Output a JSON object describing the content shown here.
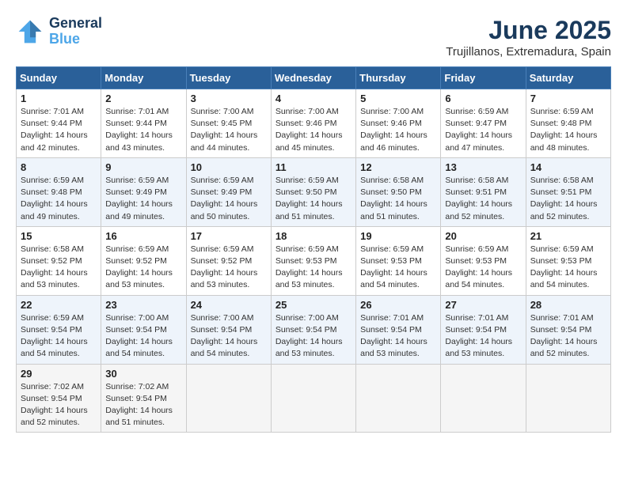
{
  "header": {
    "logo_line1": "General",
    "logo_line2": "Blue",
    "month": "June 2025",
    "location": "Trujillanos, Extremadura, Spain"
  },
  "weekdays": [
    "Sunday",
    "Monday",
    "Tuesday",
    "Wednesday",
    "Thursday",
    "Friday",
    "Saturday"
  ],
  "weeks": [
    [
      {
        "day": "1",
        "info": "Sunrise: 7:01 AM\nSunset: 9:44 PM\nDaylight: 14 hours\nand 42 minutes."
      },
      {
        "day": "2",
        "info": "Sunrise: 7:01 AM\nSunset: 9:44 PM\nDaylight: 14 hours\nand 43 minutes."
      },
      {
        "day": "3",
        "info": "Sunrise: 7:00 AM\nSunset: 9:45 PM\nDaylight: 14 hours\nand 44 minutes."
      },
      {
        "day": "4",
        "info": "Sunrise: 7:00 AM\nSunset: 9:46 PM\nDaylight: 14 hours\nand 45 minutes."
      },
      {
        "day": "5",
        "info": "Sunrise: 7:00 AM\nSunset: 9:46 PM\nDaylight: 14 hours\nand 46 minutes."
      },
      {
        "day": "6",
        "info": "Sunrise: 6:59 AM\nSunset: 9:47 PM\nDaylight: 14 hours\nand 47 minutes."
      },
      {
        "day": "7",
        "info": "Sunrise: 6:59 AM\nSunset: 9:48 PM\nDaylight: 14 hours\nand 48 minutes."
      }
    ],
    [
      {
        "day": "8",
        "info": "Sunrise: 6:59 AM\nSunset: 9:48 PM\nDaylight: 14 hours\nand 49 minutes."
      },
      {
        "day": "9",
        "info": "Sunrise: 6:59 AM\nSunset: 9:49 PM\nDaylight: 14 hours\nand 49 minutes."
      },
      {
        "day": "10",
        "info": "Sunrise: 6:59 AM\nSunset: 9:49 PM\nDaylight: 14 hours\nand 50 minutes."
      },
      {
        "day": "11",
        "info": "Sunrise: 6:59 AM\nSunset: 9:50 PM\nDaylight: 14 hours\nand 51 minutes."
      },
      {
        "day": "12",
        "info": "Sunrise: 6:58 AM\nSunset: 9:50 PM\nDaylight: 14 hours\nand 51 minutes."
      },
      {
        "day": "13",
        "info": "Sunrise: 6:58 AM\nSunset: 9:51 PM\nDaylight: 14 hours\nand 52 minutes."
      },
      {
        "day": "14",
        "info": "Sunrise: 6:58 AM\nSunset: 9:51 PM\nDaylight: 14 hours\nand 52 minutes."
      }
    ],
    [
      {
        "day": "15",
        "info": "Sunrise: 6:58 AM\nSunset: 9:52 PM\nDaylight: 14 hours\nand 53 minutes."
      },
      {
        "day": "16",
        "info": "Sunrise: 6:59 AM\nSunset: 9:52 PM\nDaylight: 14 hours\nand 53 minutes."
      },
      {
        "day": "17",
        "info": "Sunrise: 6:59 AM\nSunset: 9:52 PM\nDaylight: 14 hours\nand 53 minutes."
      },
      {
        "day": "18",
        "info": "Sunrise: 6:59 AM\nSunset: 9:53 PM\nDaylight: 14 hours\nand 53 minutes."
      },
      {
        "day": "19",
        "info": "Sunrise: 6:59 AM\nSunset: 9:53 PM\nDaylight: 14 hours\nand 54 minutes."
      },
      {
        "day": "20",
        "info": "Sunrise: 6:59 AM\nSunset: 9:53 PM\nDaylight: 14 hours\nand 54 minutes."
      },
      {
        "day": "21",
        "info": "Sunrise: 6:59 AM\nSunset: 9:53 PM\nDaylight: 14 hours\nand 54 minutes."
      }
    ],
    [
      {
        "day": "22",
        "info": "Sunrise: 6:59 AM\nSunset: 9:54 PM\nDaylight: 14 hours\nand 54 minutes."
      },
      {
        "day": "23",
        "info": "Sunrise: 7:00 AM\nSunset: 9:54 PM\nDaylight: 14 hours\nand 54 minutes."
      },
      {
        "day": "24",
        "info": "Sunrise: 7:00 AM\nSunset: 9:54 PM\nDaylight: 14 hours\nand 54 minutes."
      },
      {
        "day": "25",
        "info": "Sunrise: 7:00 AM\nSunset: 9:54 PM\nDaylight: 14 hours\nand 53 minutes."
      },
      {
        "day": "26",
        "info": "Sunrise: 7:01 AM\nSunset: 9:54 PM\nDaylight: 14 hours\nand 53 minutes."
      },
      {
        "day": "27",
        "info": "Sunrise: 7:01 AM\nSunset: 9:54 PM\nDaylight: 14 hours\nand 53 minutes."
      },
      {
        "day": "28",
        "info": "Sunrise: 7:01 AM\nSunset: 9:54 PM\nDaylight: 14 hours\nand 52 minutes."
      }
    ],
    [
      {
        "day": "29",
        "info": "Sunrise: 7:02 AM\nSunset: 9:54 PM\nDaylight: 14 hours\nand 52 minutes."
      },
      {
        "day": "30",
        "info": "Sunrise: 7:02 AM\nSunset: 9:54 PM\nDaylight: 14 hours\nand 51 minutes."
      },
      {
        "day": "",
        "info": ""
      },
      {
        "day": "",
        "info": ""
      },
      {
        "day": "",
        "info": ""
      },
      {
        "day": "",
        "info": ""
      },
      {
        "day": "",
        "info": ""
      }
    ]
  ]
}
